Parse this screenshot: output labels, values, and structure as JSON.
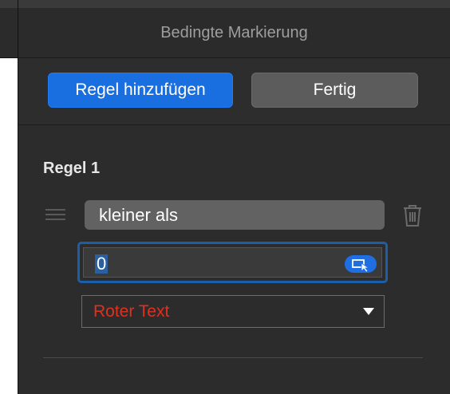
{
  "panel": {
    "title": "Bedingte Markierung",
    "add_rule_label": "Regel hinzufügen",
    "done_label": "Fertig"
  },
  "rule": {
    "title": "Regel 1",
    "condition": "kleiner als",
    "value": "0",
    "style": "Roter Text"
  },
  "colors": {
    "accent": "#1a6fe0",
    "style_text": "#e0301e",
    "panel_bg": "#2c2c2c"
  },
  "icons": [
    "drag-handle-icon",
    "trash-icon",
    "cell-reference-icon",
    "chevron-down-icon"
  ]
}
